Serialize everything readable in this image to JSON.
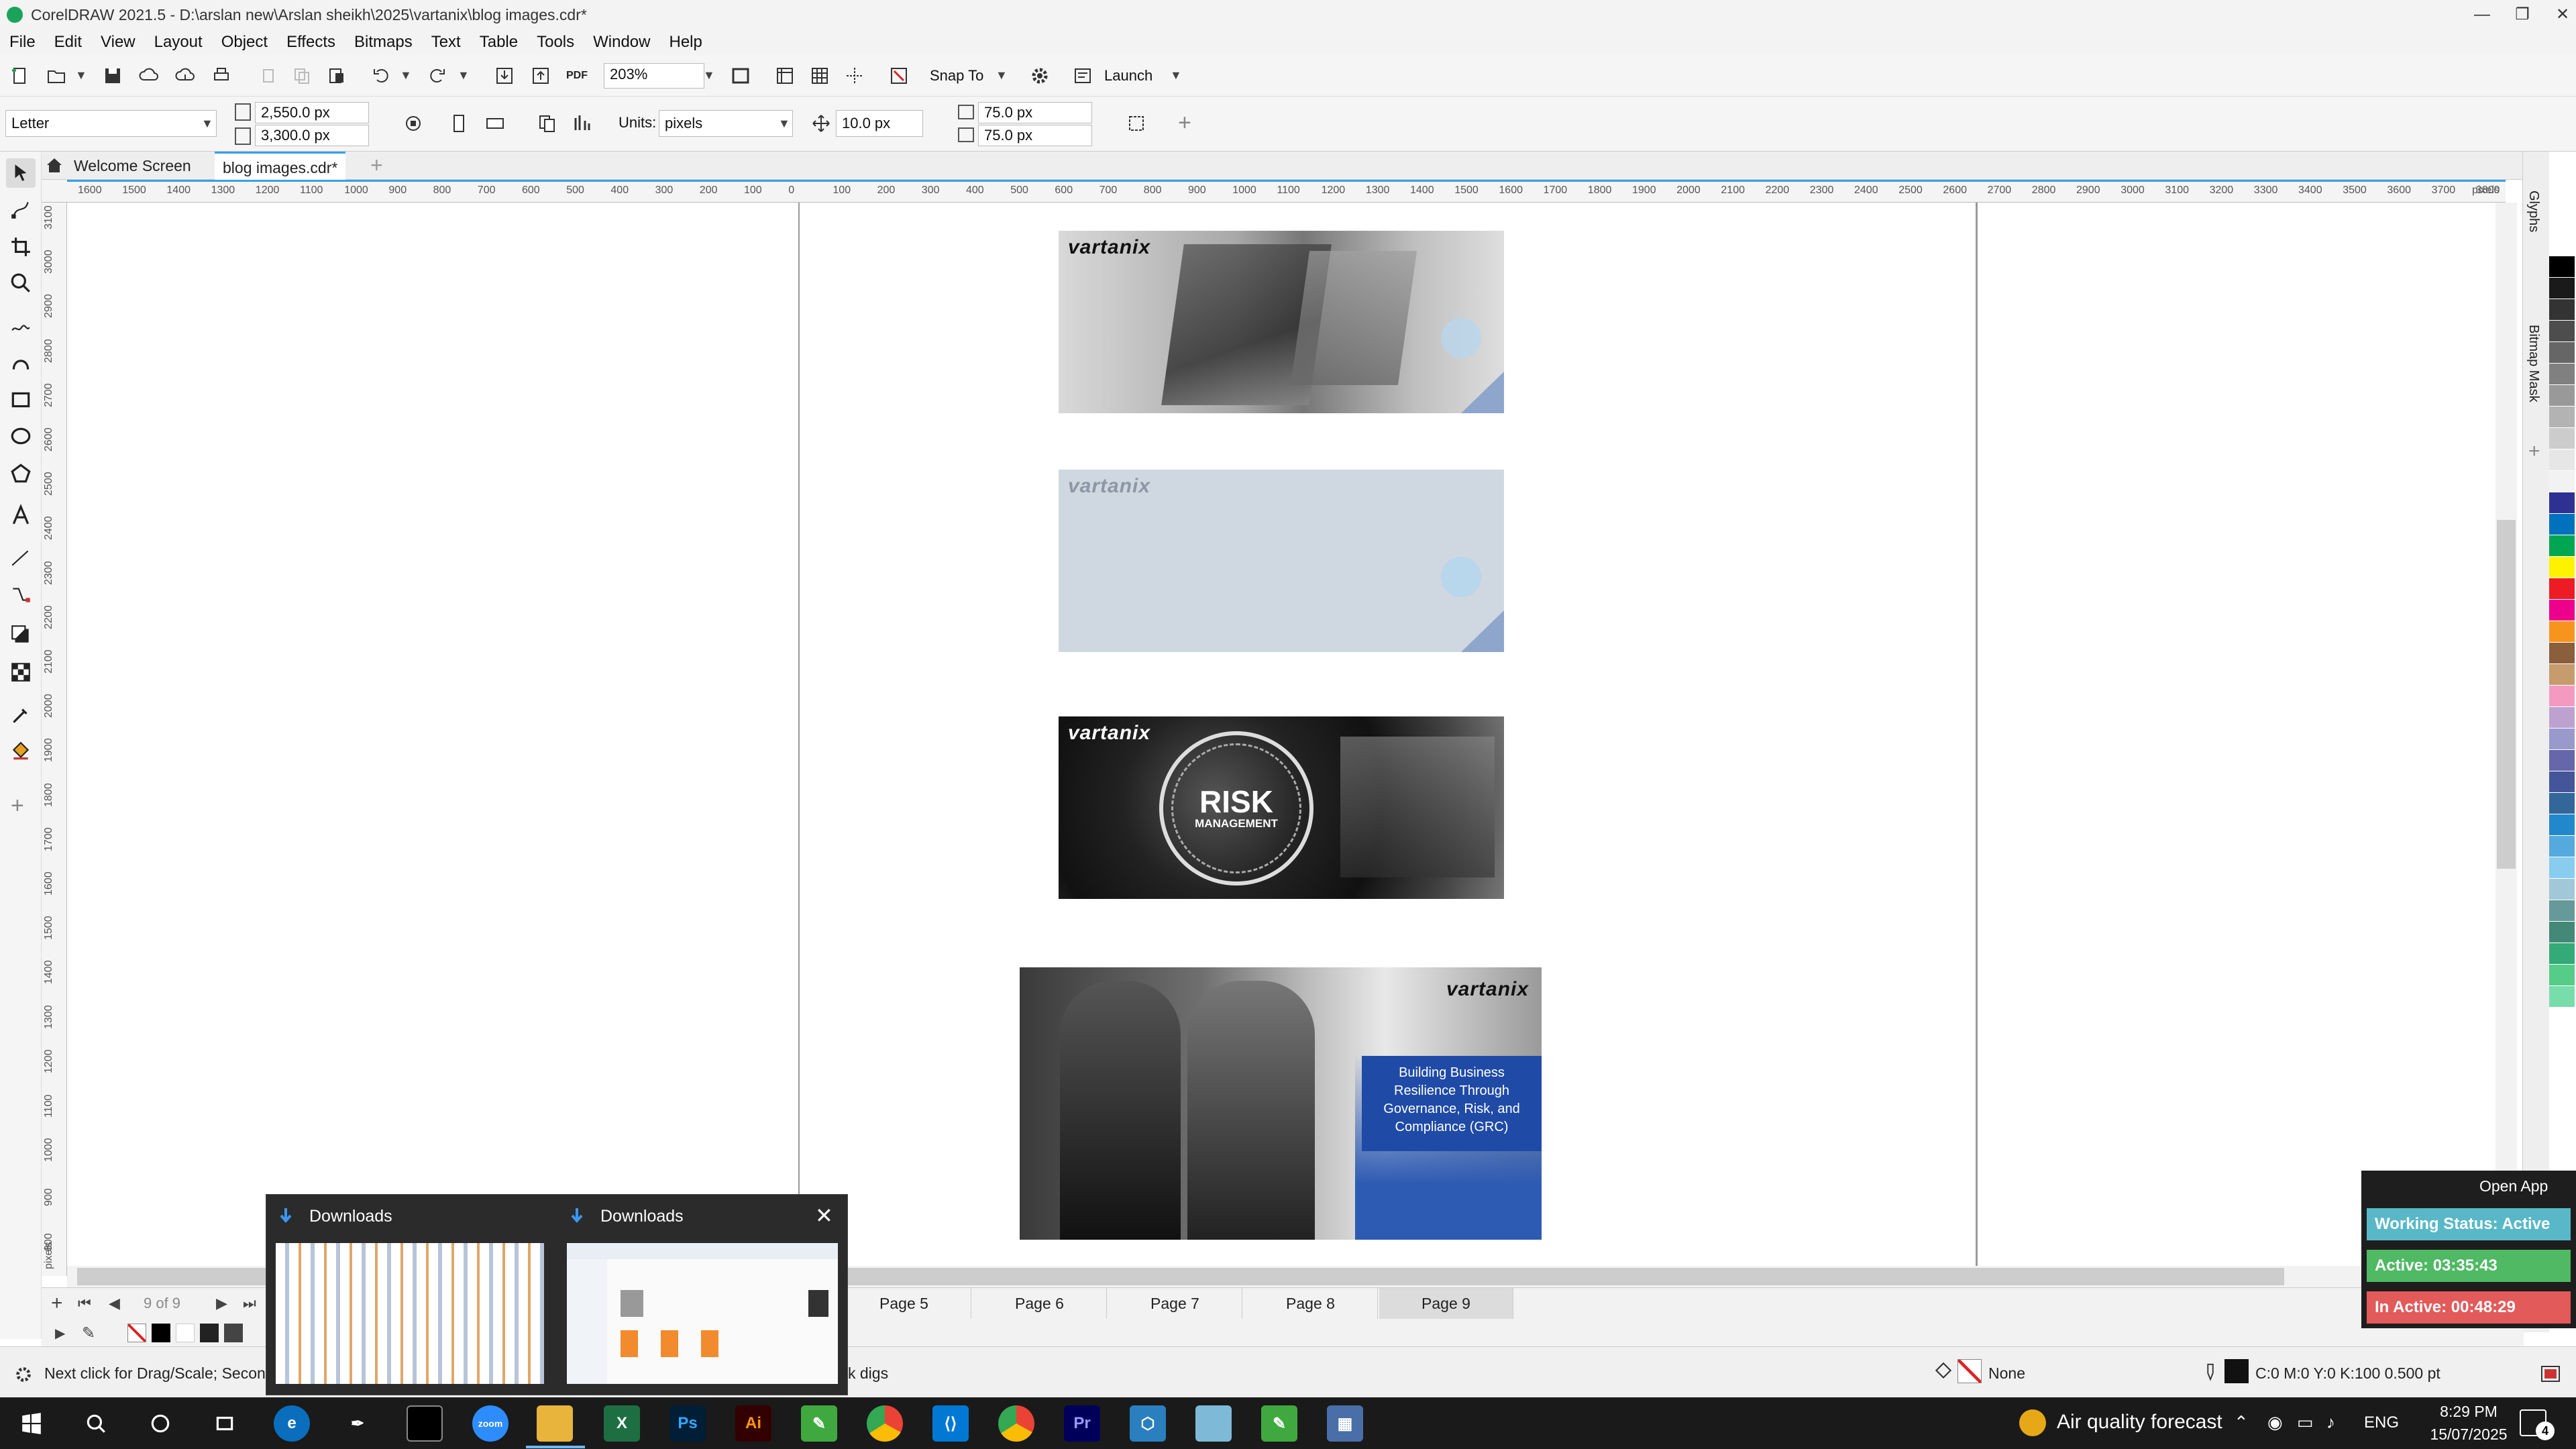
{
  "window": {
    "title": "CorelDRAW 2021.5 - D:\\arslan new\\Arslan sheikh\\2025\\vartanix\\blog images.cdr*"
  },
  "menu": [
    "File",
    "Edit",
    "View",
    "Layout",
    "Object",
    "Effects",
    "Bitmaps",
    "Text",
    "Table",
    "Tools",
    "Window",
    "Help"
  ],
  "toolbar": {
    "zoom": "203%",
    "snap_to": "Snap To",
    "launch": "Launch",
    "pdf_label": "PDF"
  },
  "property_bar": {
    "page_size": "Letter",
    "width": "2,550.0 px",
    "height": "3,300.0 px",
    "units_label": "Units:",
    "units_value": "pixels",
    "nudge": "10.0 px",
    "dup_x": "75.0 px",
    "dup_y": "75.0 px"
  },
  "doc_tabs": {
    "welcome": "Welcome Screen",
    "file": "blog images.cdr*"
  },
  "ruler": {
    "h_labels": [
      "1600",
      "1500",
      "1400",
      "1300",
      "1200",
      "1100",
      "1000",
      "900",
      "800",
      "700",
      "600",
      "500",
      "400",
      "300",
      "200",
      "100",
      "0",
      "100",
      "200",
      "300",
      "400",
      "500",
      "600",
      "700",
      "800",
      "900",
      "1000",
      "1100",
      "1200",
      "1300",
      "1400",
      "1500",
      "1600",
      "1700",
      "1800",
      "1900",
      "2000",
      "2100",
      "2200",
      "2300",
      "2400",
      "2500",
      "2600",
      "2700",
      "2800",
      "2900",
      "3000",
      "3100",
      "3200",
      "3300",
      "3400",
      "3500",
      "3600",
      "3700",
      "3800"
    ],
    "h_unit": "pixels",
    "v_labels": [
      "3100",
      "3000",
      "2900",
      "2800",
      "2700",
      "2600",
      "2500",
      "2400",
      "2300",
      "2200",
      "2100",
      "2000",
      "1900",
      "1800",
      "1700",
      "1600",
      "1500",
      "1400",
      "1300",
      "1200",
      "1100",
      "1000",
      "900",
      "800"
    ],
    "v_unit": "pixels"
  },
  "artworks": {
    "logo": "vartanix",
    "risk_title": "RISK",
    "risk_sub": "MANAGEMENT",
    "grc_text": "Building Business Resilience Through Governance, Risk, and Compliance (GRC)"
  },
  "right_dock": {
    "glyphs": "Glyphs",
    "bitmap_mask": "Bitmap Mask"
  },
  "page_nav": {
    "counter": "9 of 9",
    "tabs": [
      "Page 5",
      "Page 6",
      "Page 7",
      "Page 8",
      "Page 9"
    ],
    "active": "Page 9"
  },
  "status": {
    "hint_left": "Next click for Drag/Scale; Second c",
    "hint_right": "k digs",
    "fill": "None",
    "outline": "C:0 M:0 Y:0 K:100  0.500 pt"
  },
  "taskbar_popup": {
    "left_title": "Downloads",
    "right_title": "Downloads"
  },
  "tracker": {
    "open_app": "Open App",
    "working": "Working Status: Active",
    "active": "Active: 03:35:43",
    "inactive": "In Active: 00:48:29"
  },
  "system_tray": {
    "weather": "Air quality forecast",
    "lang": "ENG",
    "time": "8:29 PM",
    "date": "15/07/2025",
    "notifications": "4"
  },
  "taskbar_apps": [
    "start",
    "search",
    "cortana",
    "task-view",
    "pen",
    "terminal",
    "zoom",
    "file-explorer",
    "excel",
    "photoshop",
    "illustrator",
    "coreldraw",
    "chrome",
    "vscode",
    "chrome-alt",
    "premiere",
    "app-hex",
    "app-blue",
    "coreldraw-alt",
    "calculator"
  ],
  "palette_colors": [
    "#ffffff",
    "#000000",
    "#1a1a1a",
    "#333333",
    "#4d4d4d",
    "#666666",
    "#808080",
    "#999999",
    "#b3b3b3",
    "#cccccc",
    "#e6e6e6",
    "#f2f2f2",
    "#2e3192",
    "#0071bc",
    "#00a651",
    "#fff200",
    "#ed1c24",
    "#ec008c",
    "#f7941d",
    "#8b5e3c",
    "#c69c6d",
    "#f49ac1",
    "#bda2d0",
    "#9999cc",
    "#6666aa",
    "#445599",
    "#336699",
    "#2288cc",
    "#55aadd",
    "#88ccee",
    "#a0c8d8",
    "#669999",
    "#448877",
    "#33aa77",
    "#55cc88",
    "#77ddaa"
  ]
}
